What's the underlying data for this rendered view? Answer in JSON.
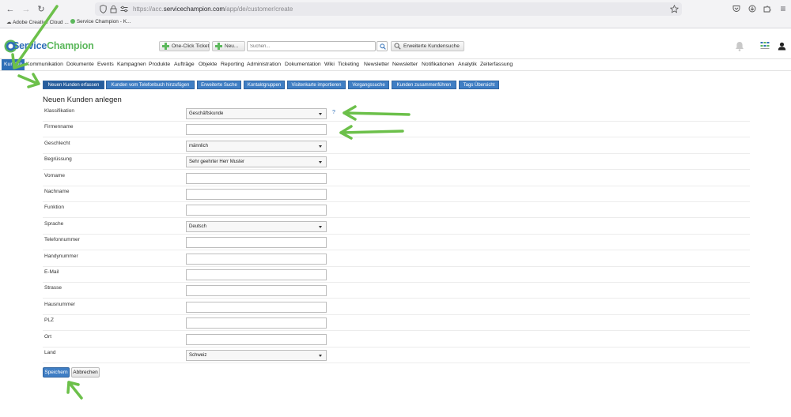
{
  "browser": {
    "url_prefix": "https://acc.",
    "url_domain": "servicechampion.com",
    "url_path": "/app/de/customer/create",
    "bookmarks": [
      "Adobe Creative Cloud ...",
      "Service Champion - K..."
    ]
  },
  "header": {
    "logo_s": "S",
    "logo_rest": "ervice",
    "logo_brand": "Champion",
    "one_click_label": "One-Click Ticket",
    "new_label": "Neu...",
    "search_placeholder": "Suchen...",
    "advanced_search_label": "Erweiterte Kundensuche"
  },
  "menu": {
    "items": [
      "Kunden",
      "Kommunikation",
      "Dokumente",
      "Events",
      "Kampagnen",
      "Produkte",
      "Aufträge",
      "Objekte",
      "Reporting",
      "Administration",
      "Dokumentation",
      "Wiki",
      "Ticketing",
      "Newsletter",
      "Newsletter",
      "Notifikationen",
      "Analytik",
      "Zeiterfassung"
    ]
  },
  "subtabs": {
    "items": [
      "Neuen Kunden erfassen",
      "Kunden vom Telefonbuch hinzufügen",
      "Erweiterte Suche",
      "Kontaktgruppen",
      "Visitenkarte importieren",
      "Vorgangssuche",
      "Kunden zusammenführen",
      "Tags Übersicht"
    ]
  },
  "form": {
    "title": "Neuen Kunden anlegen",
    "help_mark": "?",
    "fields": [
      {
        "label": "Klassifikation",
        "type": "select",
        "value": "Geschäftskunde"
      },
      {
        "label": "Firmenname",
        "type": "text",
        "value": ""
      },
      {
        "label": "Geschlecht",
        "type": "select",
        "value": "männlich"
      },
      {
        "label": "Begrüssung",
        "type": "select",
        "value": "Sehr geehrter Herr Muster"
      },
      {
        "label": "Vorname",
        "type": "text",
        "value": ""
      },
      {
        "label": "Nachname",
        "type": "text",
        "value": ""
      },
      {
        "label": "Funktion",
        "type": "text",
        "value": ""
      },
      {
        "label": "Sprache",
        "type": "select",
        "value": "Deutsch"
      },
      {
        "label": "Telefonnummer",
        "type": "text",
        "value": ""
      },
      {
        "label": "Handynummer",
        "type": "text",
        "value": ""
      },
      {
        "label": "E-Mail",
        "type": "text",
        "value": ""
      },
      {
        "label": "Strasse",
        "type": "text",
        "value": ""
      },
      {
        "label": "Hausnummer",
        "type": "text",
        "value": ""
      },
      {
        "label": "PLZ",
        "type": "text",
        "value": ""
      },
      {
        "label": "Ort",
        "type": "text",
        "value": ""
      },
      {
        "label": "Land",
        "type": "select",
        "value": "Schweiz"
      }
    ],
    "save_label": "Speichern",
    "cancel_label": "Abbrechen"
  },
  "colors": {
    "accent": "#2f6fb7",
    "annotation": "#6cc04a",
    "logo_green": "#5cb85c"
  }
}
